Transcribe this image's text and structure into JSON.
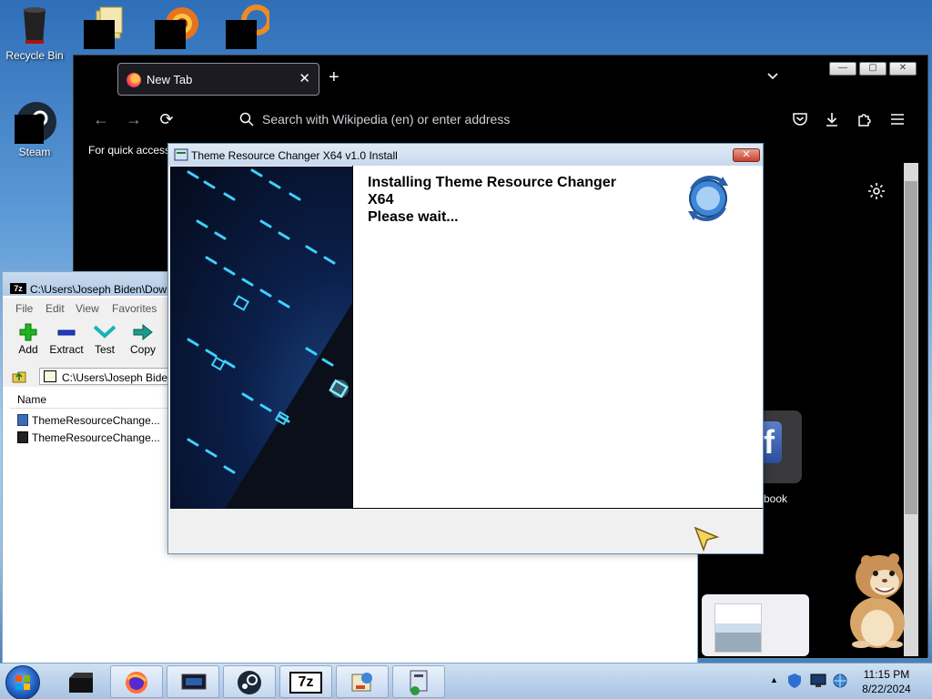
{
  "desktop": {
    "icons": [
      {
        "label": "Recycle Bin",
        "icon": "recycle-bin-icon"
      },
      {
        "label": "",
        "icon": "folder-icon"
      },
      {
        "label": "",
        "icon": "app-icon"
      },
      {
        "label": "",
        "icon": "app-icon"
      },
      {
        "label": "Steam",
        "icon": "steam-icon"
      }
    ]
  },
  "firefox": {
    "tab_title": "New Tab",
    "new_tab_symbol": "+",
    "close_symbol": "✕",
    "search_placeholder": "Search with Wikipedia (en) or enter address",
    "quick_access_text": "For quick access",
    "shortcut_label": "book",
    "window_buttons": [
      "—",
      "▢",
      "✕"
    ]
  },
  "sevenzip": {
    "title": "C:\\Users\\Joseph Biden\\Downloads\\ThemeResourceChanger",
    "menu": [
      "File",
      "Edit",
      "View",
      "Favorites"
    ],
    "toolbar": [
      "Add",
      "Extract",
      "Test",
      "Copy"
    ],
    "address": "C:\\Users\\Joseph Biden\\Downloads\\ThemeResourceChanger",
    "column_name": "Name",
    "files": [
      "ThemeResourceChange...",
      "ThemeResourceChange..."
    ]
  },
  "installer": {
    "title": "Theme Resource Changer X64 v1.0 Install",
    "close_symbol": "✕",
    "message_line1": "Installing Theme Resource Changer",
    "message_line2": "X64",
    "message_line3": "Please wait..."
  },
  "taskbar": {
    "buttons": [
      "start",
      "dark-window",
      "firefox",
      "monitor",
      "steam",
      "7zip",
      "installer-app",
      "installer-setup"
    ],
    "clock_time": "11:15 PM",
    "clock_date": "8/22/2024",
    "tray_symbol": "▲"
  },
  "colors": {
    "ff_bg": "#1c1b22",
    "dialog_close": "#c8402c",
    "taskbar_top": "#cfe0f2"
  }
}
